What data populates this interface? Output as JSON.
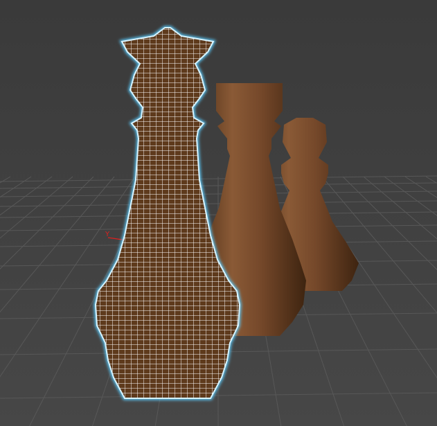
{
  "viewport": {
    "axis_label": "Y",
    "colors": {
      "background": "#3f3f3f",
      "grid": "#5a5a5a",
      "piece": "#6e4526",
      "wire": "#ffffff",
      "selection_glow": "#5ac8f8",
      "axis": "#e0201e"
    },
    "objects": [
      {
        "name": "queen",
        "selected": true,
        "display": "wireframe-on-shaded"
      },
      {
        "name": "rook",
        "selected": false,
        "display": "shaded"
      },
      {
        "name": "pawn",
        "selected": false,
        "display": "shaded"
      }
    ]
  }
}
